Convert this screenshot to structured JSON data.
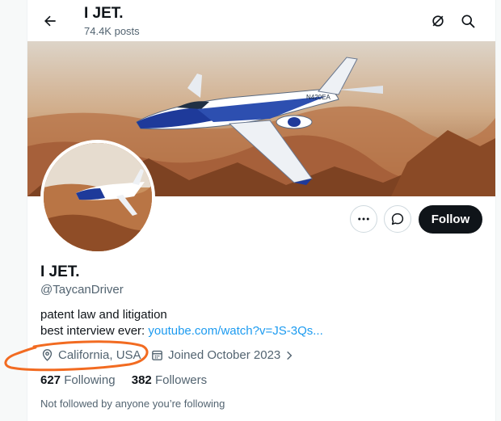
{
  "header": {
    "title": "I JET.",
    "posts_count": "74.4K posts"
  },
  "icons": {
    "back": "arrow-left-icon",
    "premium": "slashed-circle-icon",
    "search": "search-icon",
    "more": "more-icon",
    "message": "message-icon",
    "location": "location-pin-icon",
    "calendar": "calendar-icon",
    "chevron": "chevron-right-icon"
  },
  "profile": {
    "name": "I JET.",
    "handle": "@TaycanDriver",
    "bio_line1": "patent law and litigation",
    "bio_line2_prefix": "best interview ever: ",
    "bio_link": "youtube.com/watch?v=JS-3Qs...",
    "location": "California, USA",
    "joined": "Joined October 2023",
    "following_count": "627",
    "following_label": "Following",
    "followers_count": "382",
    "followers_label": "Followers",
    "not_followed": "Not followed by anyone you’re following"
  },
  "actions": {
    "follow_label": "Follow"
  },
  "banner": {
    "aircraft_registration": "N420EA"
  },
  "colors": {
    "link": "#1d9bf0",
    "annotation": "#f26b21",
    "follow_button": "#0f1419",
    "secondary_text": "#536471"
  }
}
